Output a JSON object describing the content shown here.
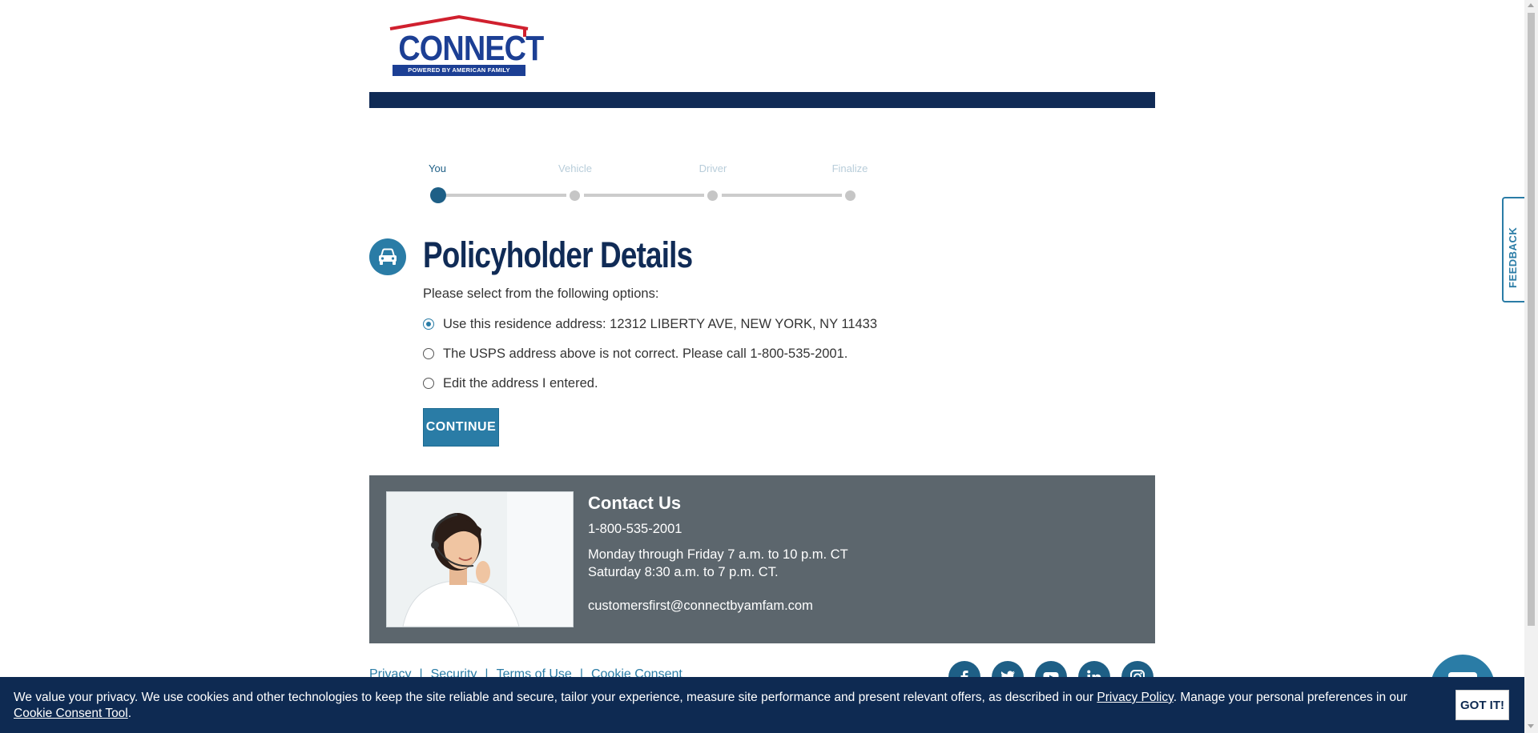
{
  "brand": {
    "logo_word": "CONNECT",
    "logo_tagline": "POWERED BY AMERICAN FAMILY INSURANCE",
    "primary": "#102b56",
    "accent": "#2a7ca6"
  },
  "progress": {
    "steps": [
      {
        "label": "You",
        "state": "active"
      },
      {
        "label": "Vehicle",
        "state": "inactive"
      },
      {
        "label": "Driver",
        "state": "inactive"
      },
      {
        "label": "Finalize",
        "state": "inactive"
      }
    ],
    "current_step": 1
  },
  "main": {
    "heading": "Policyholder Details",
    "heading_icon": "car-icon",
    "prompt": "Please select from the following options:",
    "options": [
      {
        "label": "Use this residence address: 12312 LIBERTY AVE, NEW YORK, NY 11433",
        "checked": true
      },
      {
        "label": "The USPS address above is not correct. Please call 1-800-535-2001.",
        "checked": false
      },
      {
        "label": "Edit the address I entered.",
        "checked": false
      }
    ],
    "continue_label": "CONTINUE"
  },
  "contact": {
    "title": "Contact Us",
    "phone": "1-800-535-2001",
    "hours_weekday": "Monday through Friday 7 a.m. to 10 p.m. CT",
    "hours_saturday": "Saturday 8:30 a.m. to 7 p.m. CT.",
    "email": "customersfirst@connectbyamfam.com"
  },
  "footer": {
    "links": [
      "Privacy",
      "Security",
      "Terms of Use",
      "Cookie Consent"
    ],
    "social": [
      "facebook-icon",
      "twitter-icon",
      "youtube-icon",
      "linkedin-icon",
      "instagram-icon"
    ]
  },
  "feedback_label": "FEEDBACK",
  "cookie": {
    "text_before": "We value your privacy. We use cookies and other technologies to keep the site reliable and secure, tailor your experience, measure site performance and present relevant offers, as described in our ",
    "privacy_link": "Privacy Policy",
    "text_middle": ". Manage your personal preferences in our ",
    "tool_link": "Cookie Consent Tool",
    "text_after": ".",
    "button": "GOT IT!"
  }
}
